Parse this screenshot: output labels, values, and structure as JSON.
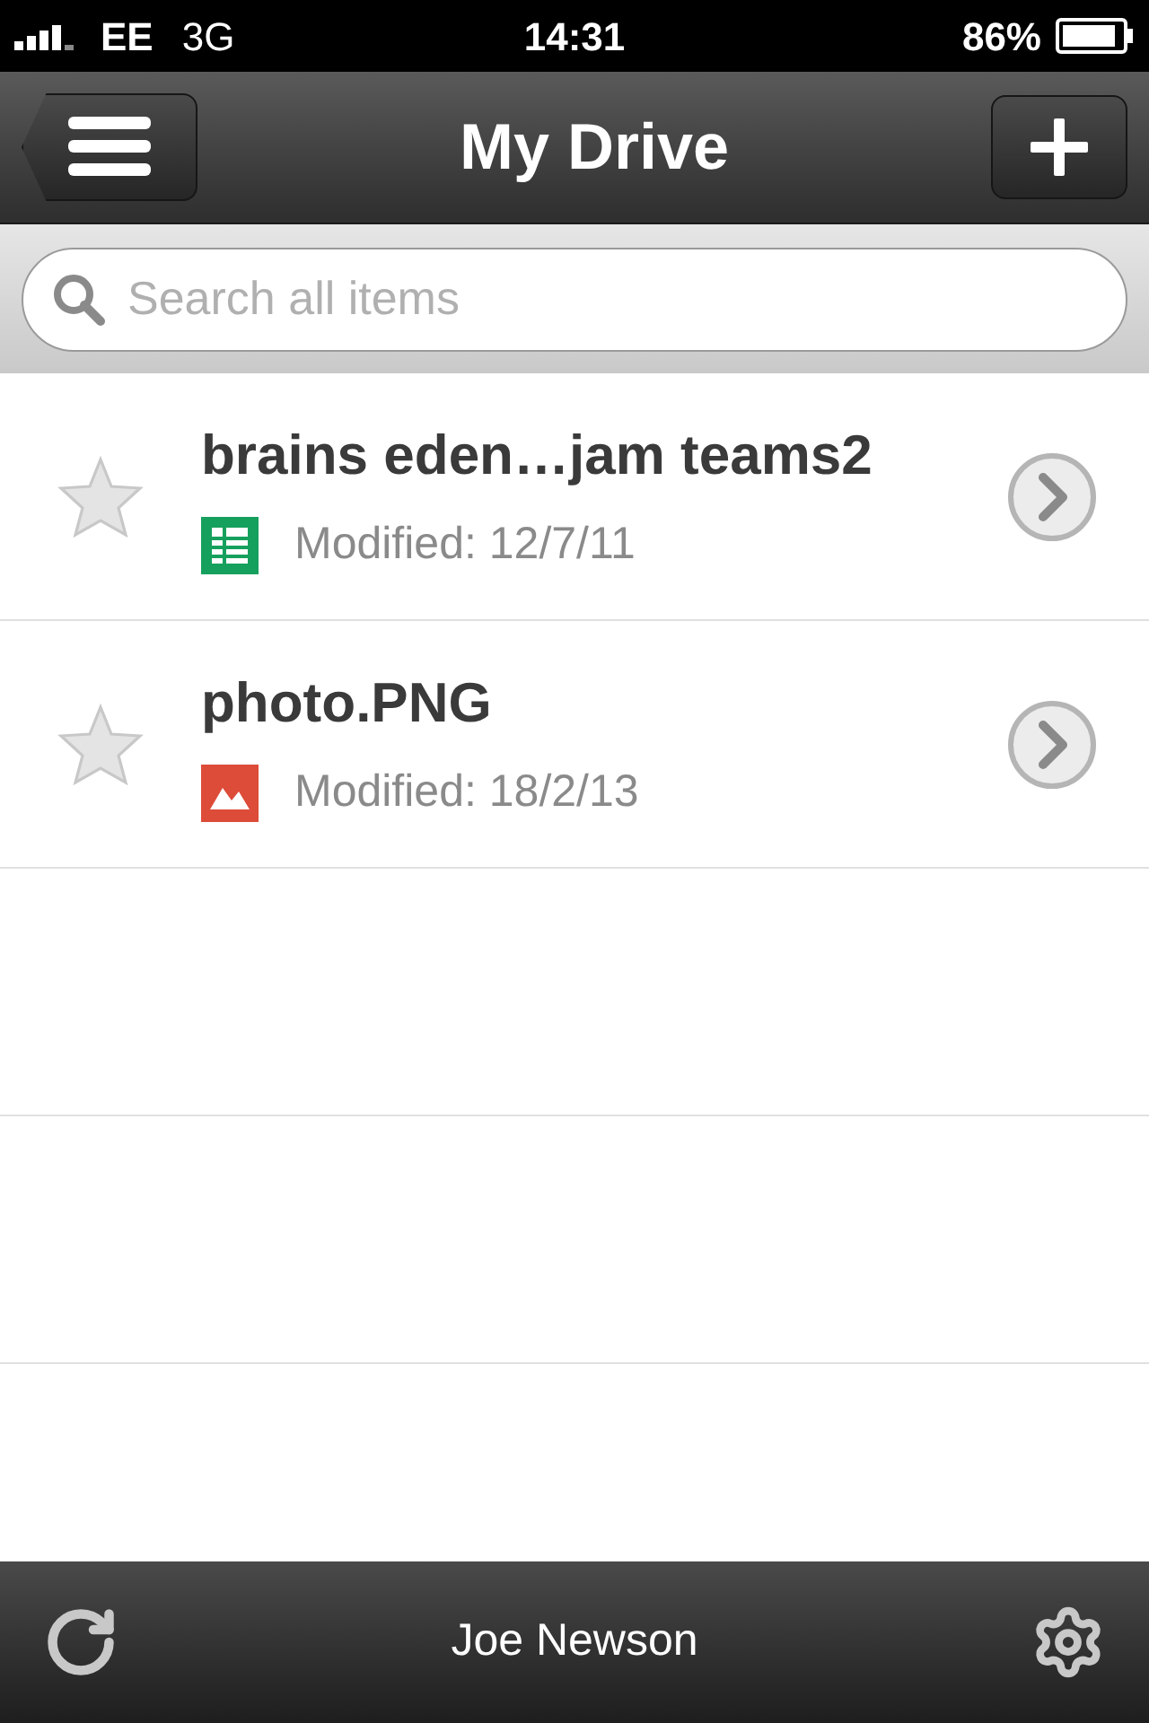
{
  "status_bar": {
    "carrier": "EE",
    "network": "3G",
    "time": "14:31",
    "battery": "86%"
  },
  "nav_bar": {
    "title": "My Drive"
  },
  "search": {
    "placeholder": "Search all items"
  },
  "files": [
    {
      "name": "brains eden…jam teams2",
      "kind": "spreadsheet",
      "modified": "Modified: 12/7/11",
      "starred": false
    },
    {
      "name": "photo.PNG",
      "kind": "image",
      "modified": "Modified: 18/2/13",
      "starred": false
    }
  ],
  "footer": {
    "user": "Joe Newson"
  }
}
